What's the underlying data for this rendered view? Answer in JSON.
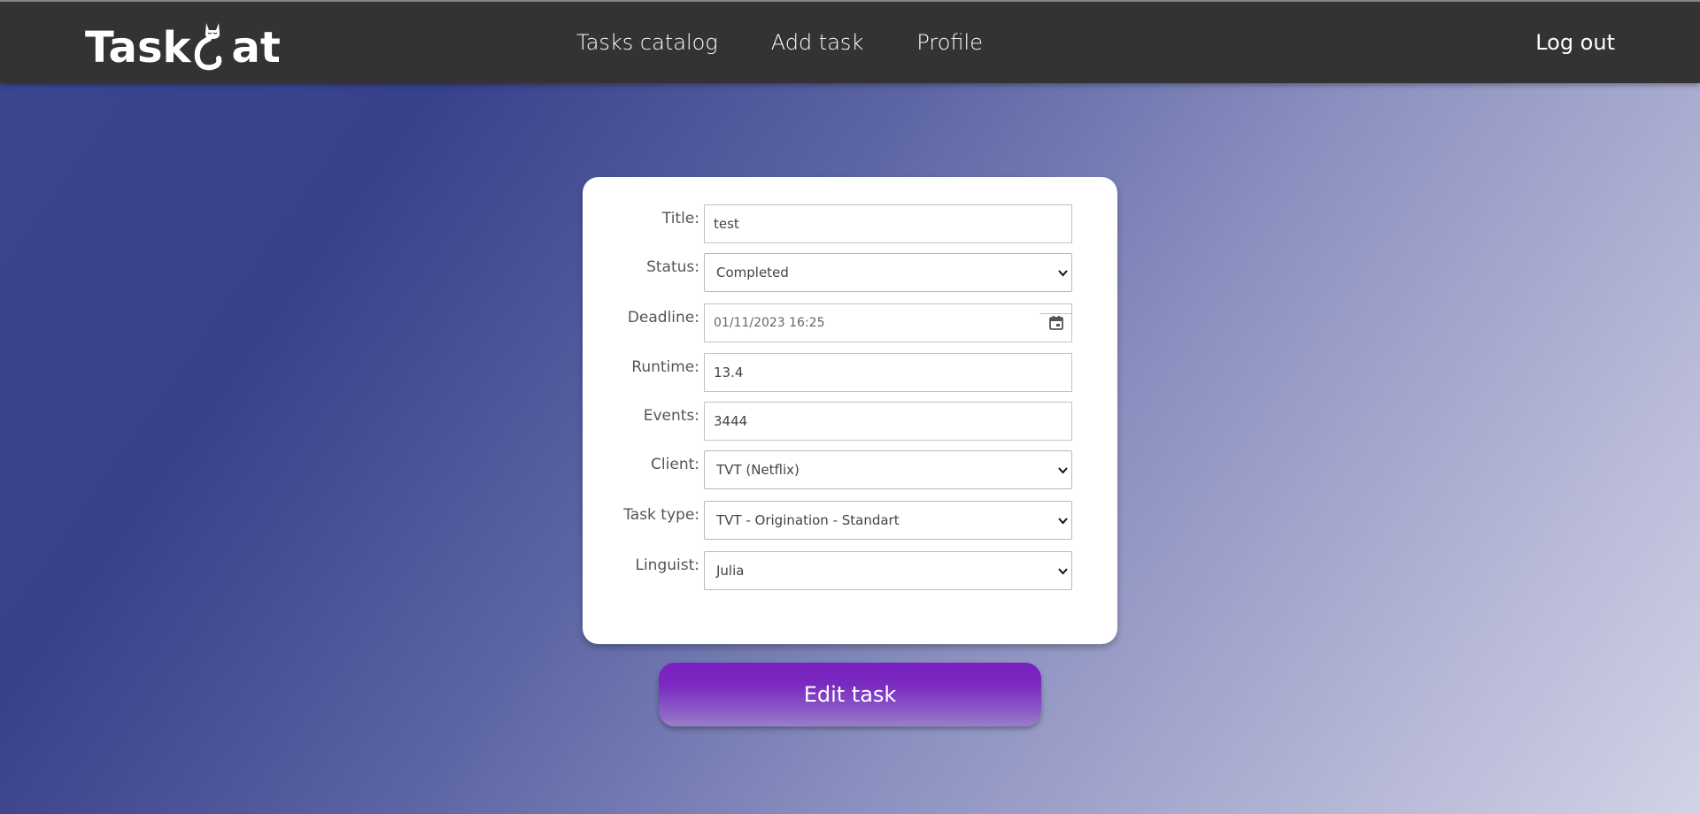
{
  "app": {
    "logo_prefix": "Task",
    "logo_suffix": "at"
  },
  "nav": {
    "items": [
      {
        "label": "Tasks catalog"
      },
      {
        "label": "Add task"
      },
      {
        "label": "Profile"
      }
    ],
    "logout_label": "Log out"
  },
  "form": {
    "title": {
      "label": "Title:",
      "value": "test"
    },
    "status": {
      "label": "Status:",
      "value": "Completed"
    },
    "deadline": {
      "label": "Deadline:",
      "value": "01/11/2023 16:25"
    },
    "runtime": {
      "label": "Runtime:",
      "value": "13.4"
    },
    "events": {
      "label": "Events:",
      "value": "3444"
    },
    "client": {
      "label": "Client:",
      "value": "TVT (Netflix)"
    },
    "task_type": {
      "label": "Task type:",
      "value": "TVT - Origination - Standart"
    },
    "linguist": {
      "label": "Linguist:",
      "value": "Julia"
    }
  },
  "edit_button_label": "Edit task",
  "icons": {
    "logo": "cat-icon",
    "select": "chevron-down-icon",
    "deadline": "calendar-icon"
  },
  "colors": {
    "navbar": "#333333",
    "button_top": "#7a1fc0",
    "background_dark": "#38418b",
    "background_light": "#d2d3e6"
  }
}
